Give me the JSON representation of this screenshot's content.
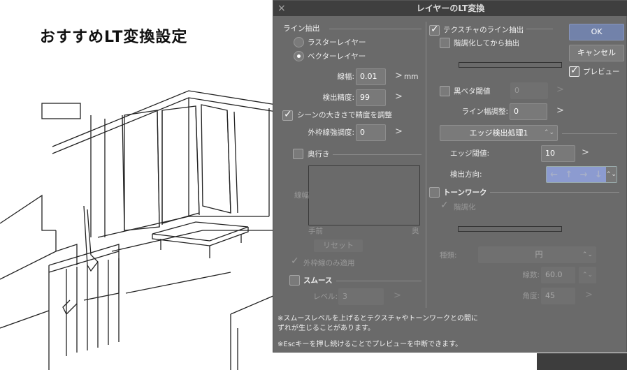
{
  "headline": "おすすめLT変換設定",
  "dialog": {
    "title": "レイヤーのLT変換",
    "close": "×",
    "line_extract": {
      "heading": "ライン抽出",
      "raster": "ラスターレイヤー",
      "vector": "ベクターレイヤー",
      "selected": "vector",
      "line_width_label": "線幅:",
      "line_width": "0.01",
      "unit": "mm",
      "precision_label": "検出精度:",
      "precision": "99",
      "scene_adjust": "シーンの大きさで精度を調整",
      "scene_adjust_checked": true,
      "outline_label": "外枠線強調度:",
      "outline": "0",
      "depth": "奥行き",
      "depth_checked": false,
      "graph_ylabel": "線幅",
      "graph_near": "手前",
      "graph_far": "奥",
      "reset": "リセット",
      "outline_only": "外枠線のみ適用",
      "smooth": "スムース",
      "smooth_checked": false,
      "level_label": "レベル:",
      "level": "3"
    },
    "texture": {
      "heading": "テクスチャのライン抽出",
      "checked": true,
      "posterize": "階調化してから抽出",
      "posterize_checked": false,
      "black_label": "黒ベタ閾値",
      "black": "0",
      "linewidth_adj_label": "ライン幅調整:",
      "linewidth_adj": "0",
      "edge_mode": "エッジ検出処理1",
      "edge_thresh_label": "エッジ閾値:",
      "edge_thresh": "10",
      "direction_label": "検出方向:",
      "directions": [
        "←",
        "↑",
        "→",
        "↓"
      ]
    },
    "tone": {
      "heading": "トーンワーク",
      "checked": false,
      "posterize": "階調化",
      "type_label": "種類:",
      "type": "円",
      "lines_label": "線数:",
      "lines": "60.0",
      "angle_label": "角度:",
      "angle": "45"
    },
    "ok": "OK",
    "cancel": "キャンセル",
    "preview": "プレビュー",
    "preview_checked": true,
    "spin": "⌃⌄",
    "arrow": ">",
    "note1": "※スムースレベルを上げるとテクスチャやトーンワークとの間に",
    "note2": "ずれが生じることがあります。",
    "note3": "※Escキーを押し続けることでプレビューを中断できます。",
    "accent": "#7282aa"
  }
}
